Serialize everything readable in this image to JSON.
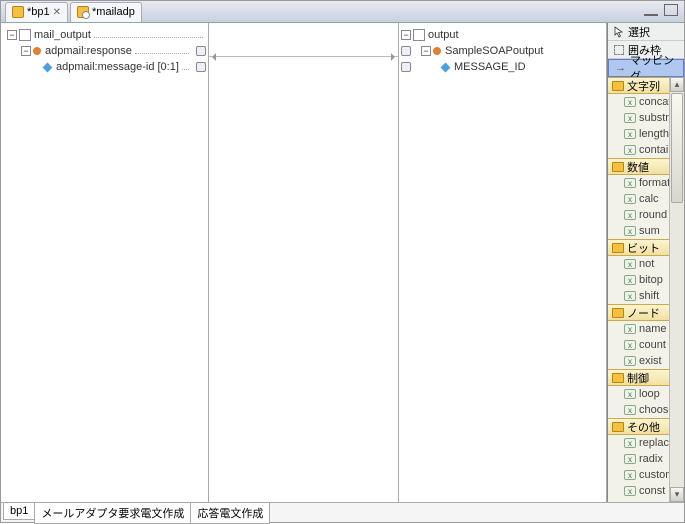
{
  "tabs": [
    {
      "label": "*bp1",
      "closable": true
    },
    {
      "label": "*mailadp",
      "closable": false
    }
  ],
  "left_tree": {
    "root": "mail_output",
    "child": "adpmail:response",
    "leaf": "adpmail:message-id [0:1]"
  },
  "right_tree": {
    "root": "output",
    "child": "SampleSOAPoutput",
    "leaf": "MESSAGE_ID"
  },
  "palette_top": {
    "select": "選択",
    "marquee": "囲み枠",
    "mapping": "マッピング"
  },
  "palette_groups": [
    {
      "title": "文字列",
      "items": [
        "concat",
        "substr",
        "length",
        "contain"
      ]
    },
    {
      "title": "数値",
      "items": [
        "format",
        "calc",
        "round",
        "sum"
      ]
    },
    {
      "title": "ビット",
      "items": [
        "not",
        "bitop",
        "shift"
      ]
    },
    {
      "title": "ノード",
      "items": [
        "name",
        "count",
        "exist"
      ]
    },
    {
      "title": "制御",
      "items": [
        "loop",
        "choose"
      ]
    },
    {
      "title": "その他",
      "items": [
        "replace",
        "radix",
        "custom",
        "const"
      ]
    }
  ],
  "bottom_tabs": [
    "bp1",
    "メールアダプタ要求電文作成",
    "応答電文作成"
  ]
}
